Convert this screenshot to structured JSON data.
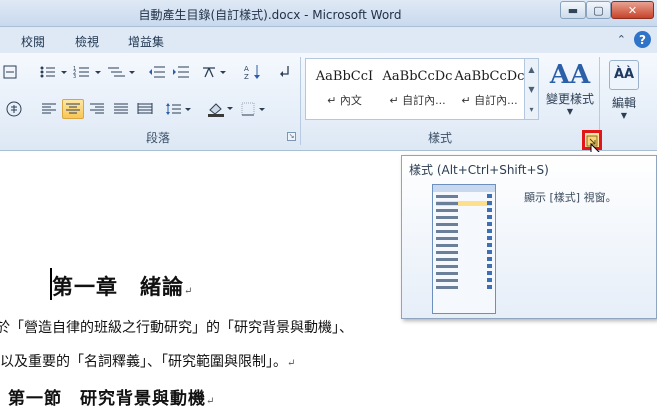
{
  "window": {
    "title": "自動產生目錄(自訂樣式).docx - Microsoft Word",
    "min_glyph": "▬",
    "max_glyph": "▢",
    "close_glyph": "✕"
  },
  "tabs": [
    "校閱",
    "檢視",
    "增益集"
  ],
  "help": {
    "icon_glyph": "?",
    "collapse_glyph": "⌃"
  },
  "ribbon": {
    "paragraph_group_label": "段落",
    "styles_group_label": "樣式",
    "style_gallery": [
      {
        "sample": "AaBbCcI",
        "name": "↵ 內文"
      },
      {
        "sample": "AaBbCcDc",
        "name": "↵ 自訂內..."
      },
      {
        "sample": "AaBbCcDc",
        "name": "↵ 自訂內..."
      }
    ],
    "change_styles_label": "變更樣式",
    "editing_label": "編輯",
    "change_styles_icon": "AA",
    "editing_icon": "ÀÀ"
  },
  "tooltip": {
    "title": "樣式 (Alt+Ctrl+Shift+S)",
    "description": "顯示 [樣式] 視窗。"
  },
  "document": {
    "heading1": "第一章　緒論",
    "body_line1": "於「營造自律的班級之行動研究」的「研究背景與動機」、",
    "body_line2": "以及重要的「名詞釋義」、「研究範圍與限制」。",
    "heading2": "第一節　研究背景與動機",
    "para_mark": "↵"
  }
}
